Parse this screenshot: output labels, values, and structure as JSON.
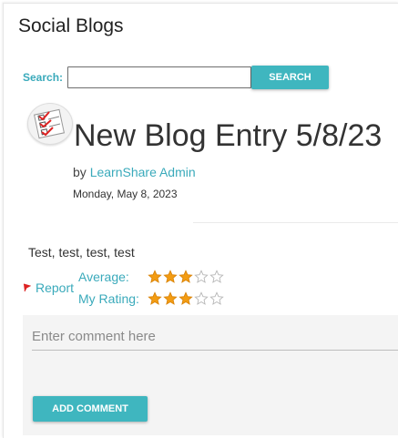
{
  "header": {
    "title": "Social Blogs"
  },
  "search": {
    "label": "Search:",
    "placeholder": "",
    "value": "",
    "button_label": "SEARCH"
  },
  "entry": {
    "title": "New Blog Entry 5/8/23",
    "by_prefix": "by",
    "author": "LearnShare Admin",
    "date": "Monday, May 8, 2023",
    "body": "Test, test, test, test"
  },
  "report": {
    "label": "Report",
    "icon": "flag-icon"
  },
  "ratings": {
    "average_label": "Average:",
    "average_value": 3,
    "my_label": "My Rating:",
    "my_value": 3,
    "max": 5,
    "filled_color": "#f39c12",
    "empty_color": "#b5b5b5"
  },
  "comment": {
    "placeholder": "Enter comment here",
    "button_label": "ADD COMMENT"
  },
  "colors": {
    "accent": "#3fb6bf",
    "link": "#3aaabb"
  }
}
